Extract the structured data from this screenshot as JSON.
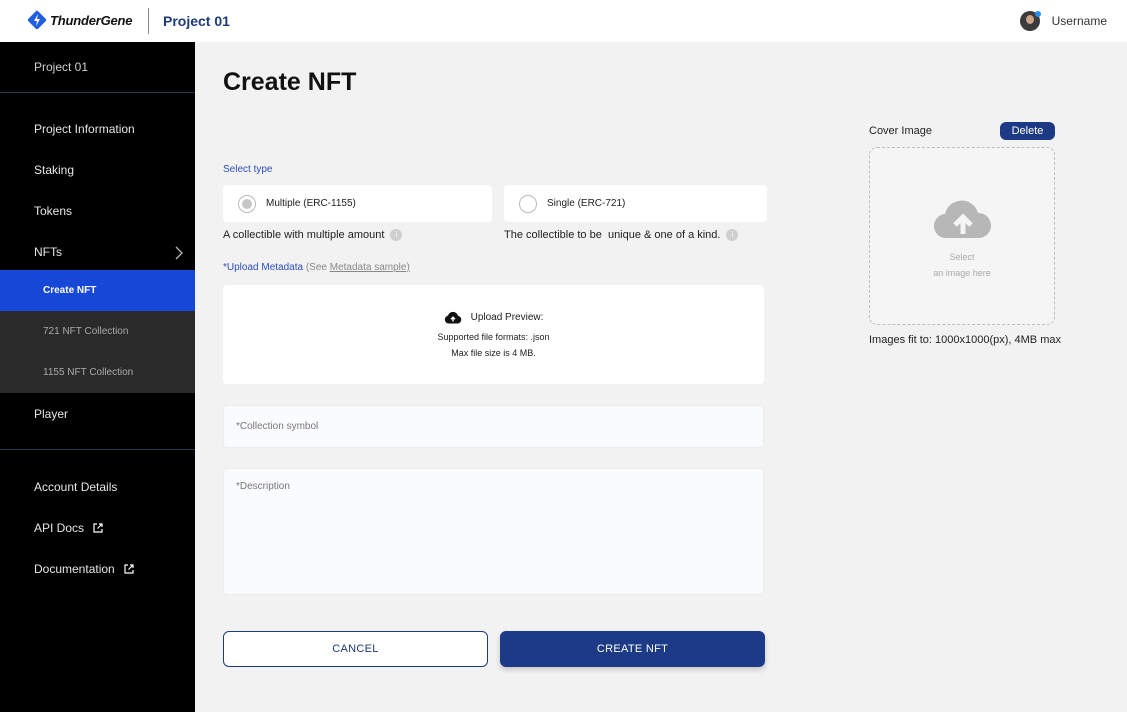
{
  "header": {
    "brand": "ThunderGene",
    "project": "Project 01",
    "username": "Username"
  },
  "sidebar": {
    "project": "Project 01",
    "items": [
      {
        "label": "Project Information"
      },
      {
        "label": "Staking"
      },
      {
        "label": "Tokens"
      },
      {
        "label": "NFTs"
      },
      {
        "label": "Create NFT"
      },
      {
        "label": "721 NFT Collection"
      },
      {
        "label": "1155 NFT Collection"
      },
      {
        "label": "Player"
      },
      {
        "label": "Account Details"
      },
      {
        "label": "API Docs"
      },
      {
        "label": "Documentation"
      }
    ]
  },
  "main": {
    "title": "Create NFT",
    "select_type_label": "Select type",
    "options": [
      {
        "label": "Multiple (ERC-1155)",
        "hint": "A collectible with multiple amount",
        "selected": true
      },
      {
        "label": "Single (ERC-721)",
        "hint": "The collectible to be  unique & one of a kind.",
        "selected": false
      }
    ],
    "upload": {
      "label": "*Upload Metadata",
      "see_prefix": "(See",
      "sample_link": "Metadata sample)",
      "preview_title": "Upload Preview:",
      "formats": "Supported file formats: .json",
      "max_size": "Max file size is 4 MB."
    },
    "collection_symbol_placeholder": "*Collection symbol",
    "description_placeholder": "*Description",
    "cancel_label": "CANCEL",
    "create_label": "CREATE NFT"
  },
  "cover": {
    "label": "Cover Image",
    "delete_label": "Delete",
    "select_line1": "Select",
    "select_line2": "an image here",
    "note": "Images fit to: 1000x1000(px), 4MB max"
  },
  "colors": {
    "primary": "#1c3a85",
    "active_nav": "#1747d6",
    "link": "#2b4fbf",
    "sidebar_bg": "#000000"
  }
}
